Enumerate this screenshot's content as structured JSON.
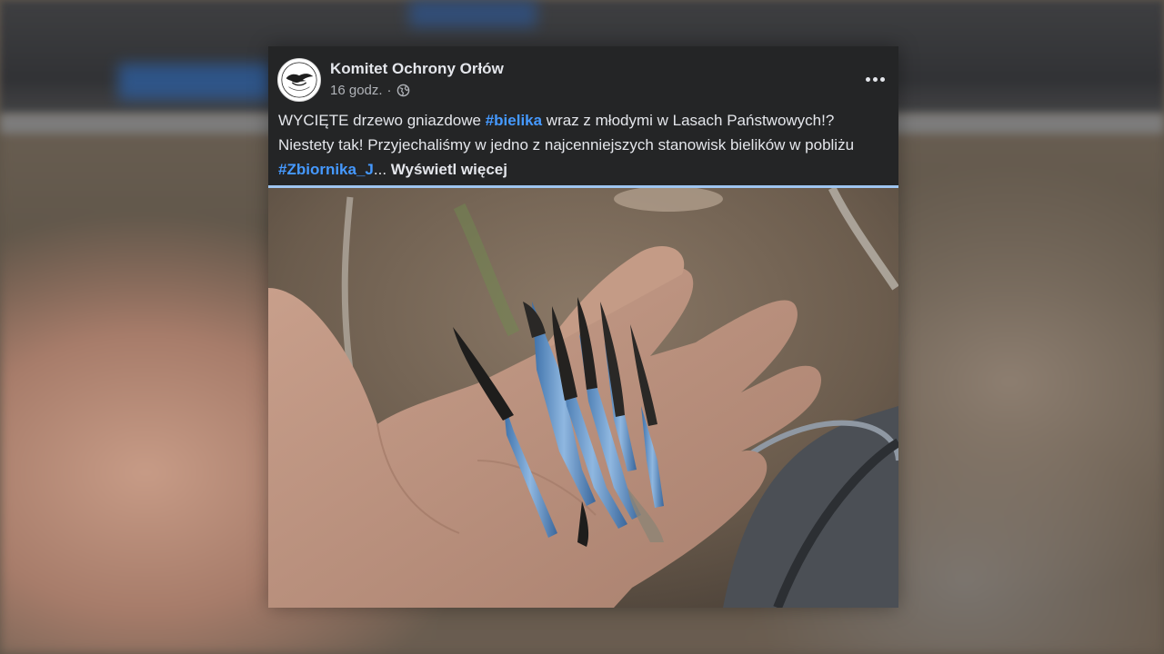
{
  "post": {
    "author": "Komitet Ochrony Orłów",
    "time": "16 godz.",
    "separator": "·",
    "privacy_icon": "globe-icon",
    "text": {
      "part1": "WYCIĘTE drzewo gniazdowe ",
      "hashtag1": "#bielika",
      "part2": " wraz z młodymi w Lasach Państwowych!? Niestety tak! Przyjechaliśmy w jedno z najcenniejszych stanowisk bielików w pobliżu ",
      "hashtag2": "#Zbiornika_J",
      "ellipsis": "... ",
      "see_more": "Wyświetl więcej"
    },
    "more_icon": "more-horizontal-icon"
  },
  "colors": {
    "card_bg": "#242526",
    "text": "#e4e6eb",
    "secondary": "#b0b3b8",
    "link": "#4599ff"
  }
}
